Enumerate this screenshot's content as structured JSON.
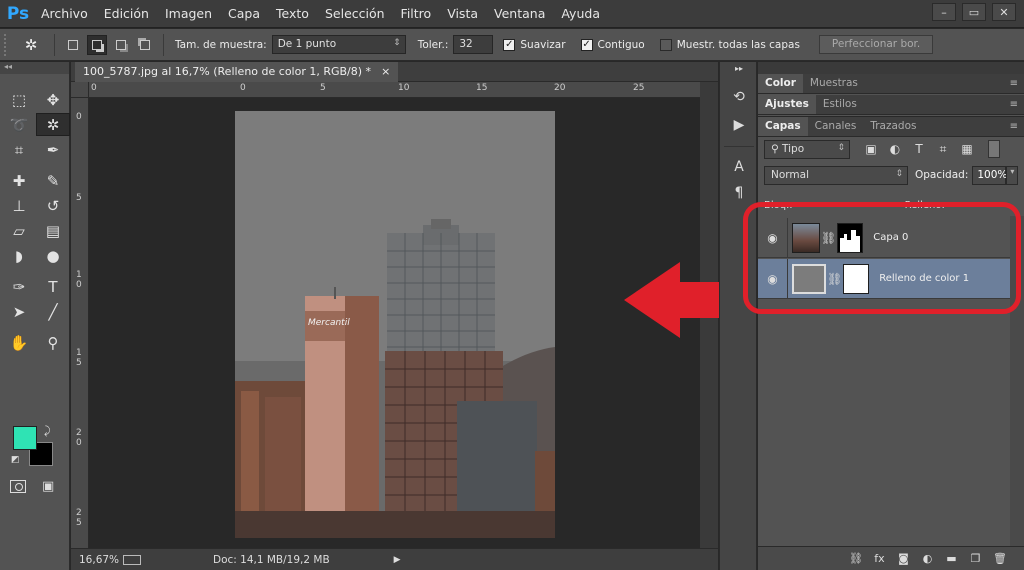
{
  "app": {
    "logo": "Ps",
    "menu": [
      "Archivo",
      "Edición",
      "Imagen",
      "Capa",
      "Texto",
      "Selección",
      "Filtro",
      "Vista",
      "Ventana",
      "Ayuda"
    ],
    "window_buttons": [
      "–",
      "▭",
      "✕"
    ]
  },
  "options_bar": {
    "tool_icon": "magic-wand-icon",
    "sample_size_label": "Tam. de muestra:",
    "sample_size_value": "De 1 punto",
    "tolerance_label": "Toler.:",
    "tolerance_value": "32",
    "antialias_label": "Suavizar",
    "antialias_checked": true,
    "contiguous_label": "Contiguo",
    "contiguous_checked": true,
    "sample_all_label": "Muestr. todas las capas",
    "sample_all_checked": false,
    "refine_button": "Perfeccionar bor."
  },
  "document": {
    "tab_title": "100_5787.jpg al 16,7% (Relleno de color 1, RGB/8) *",
    "tab_close": "×",
    "ruler_h_labels": [
      "0",
      "0",
      "5",
      "10",
      "15",
      "20",
      "25"
    ],
    "ruler_v_labels": [
      "0",
      "5",
      "1 0",
      "1 5",
      "2 0",
      "2 5"
    ],
    "zoom": "16,67%",
    "doc_info": "Doc: 14,1 MB/19,2 MB"
  },
  "colors": {
    "foreground": "#2fe3b4",
    "background": "#000000",
    "annotation_red": "#e0202a",
    "selected_layer": "#6c7f9b"
  },
  "panels": {
    "top_tabs": [
      "Color",
      "Muestras"
    ],
    "adjust_tabs": [
      "Ajustes",
      "Estilos"
    ],
    "layers_tabs": [
      "Capas",
      "Canales",
      "Trazados"
    ],
    "filter_value": "Tipo",
    "blend_mode": "Normal",
    "opacity_label": "Opacidad:",
    "opacity_value": "100%",
    "lock_label": "Bloq.:",
    "fill_label": "Relleno:",
    "layers": [
      {
        "name": "Capa 0",
        "selected": false,
        "visible": true
      },
      {
        "name": "Relleno de color 1",
        "selected": true,
        "visible": true
      }
    ]
  }
}
